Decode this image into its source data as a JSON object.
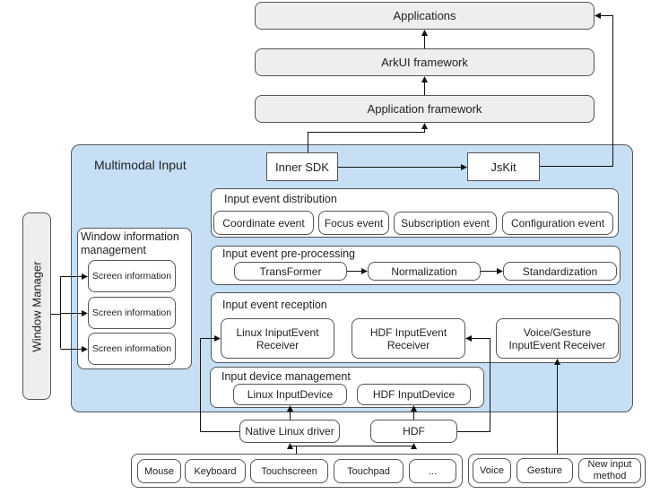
{
  "top_layers": {
    "applications": "Applications",
    "arkui": "ArkUI framework",
    "app_framework": "Application framework"
  },
  "multimodal": {
    "title": "Multimodal Input",
    "inner_sdk": "Inner SDK",
    "jskit": "JsKit",
    "fill_color": "#c6dff5"
  },
  "window_manager": "Window Manager",
  "window_info": {
    "title": "Window information management",
    "items": [
      "Screen information",
      "Screen information",
      "Screen information"
    ]
  },
  "distribution": {
    "title": "Input event distribution",
    "items": [
      "Coordinate event",
      "Focus event",
      "Subscription event",
      "Configuration event"
    ]
  },
  "preprocessing": {
    "title": "Input event pre-processing",
    "items": [
      "TransFormer",
      "Normalization",
      "Standardization"
    ]
  },
  "reception": {
    "title": "Input event reception",
    "items": [
      "Linux IniputEvent Receiver",
      "HDF InputEvent Receiver",
      "Voice/Gesture InputEvent Receiver"
    ]
  },
  "device_mgmt": {
    "title": "Input device management",
    "items": [
      "Linux InputDevice",
      "HDF InputDevice"
    ]
  },
  "drivers": {
    "native_linux": "Native Linux driver",
    "hdf": "HDF"
  },
  "hardware_devices": [
    "Mouse",
    "Keyboard",
    "Touchscreen",
    "Touchpad",
    "..."
  ],
  "other_inputs": [
    "Voice",
    "Gesture",
    "New input method"
  ]
}
